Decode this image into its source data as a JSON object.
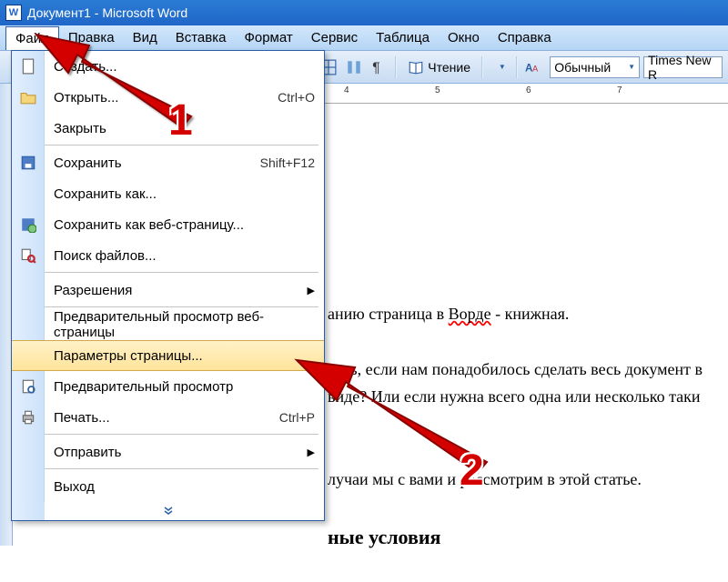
{
  "title": "Документ1 - Microsoft Word",
  "menubar": {
    "file": "Файл",
    "edit": "Правка",
    "view": "Вид",
    "insert": "Вставка",
    "format": "Формат",
    "tools": "Сервис",
    "table": "Таблица",
    "window": "Окно",
    "help": "Справка"
  },
  "toolbar": {
    "read_label": "Чтение",
    "style_value": "Обычный",
    "font_value": "Times New R"
  },
  "ruler": {
    "t4": "4",
    "t5": "5",
    "t6": "6",
    "t7": "7"
  },
  "file_menu": {
    "create": "Создать...",
    "open": "Открыть...",
    "open_sc": "Ctrl+O",
    "close": "Закрыть",
    "save": "Сохранить",
    "save_sc": "Shift+F12",
    "save_as": "Сохранить как...",
    "save_web": "Сохранить как веб-страницу...",
    "file_search": "Поиск файлов...",
    "permissions": "Разрешения",
    "web_preview": "Предварительный просмотр веб-страницы",
    "page_setup": "Параметры страницы...",
    "print_preview": "Предварительный просмотр",
    "print": "Печать...",
    "print_sc": "Ctrl+P",
    "send": "Отправить",
    "exit": "Выход"
  },
  "document": {
    "p1_a": "анию страница в ",
    "p1_b": "Ворде",
    "p1_c": " - книжная.",
    "p2": "лать, если нам понадобилось сделать весь документ в",
    "p3_a": "виде? Или если нужна всего одна или несколько таки",
    "p4": "лучаи мы с вами и рассмотрим в этой статье.",
    "h2": "ные условия"
  },
  "callouts": {
    "one": "1",
    "two": "2"
  },
  "colors": {
    "accent": "#1f66c8",
    "arrow": "#d40000"
  }
}
